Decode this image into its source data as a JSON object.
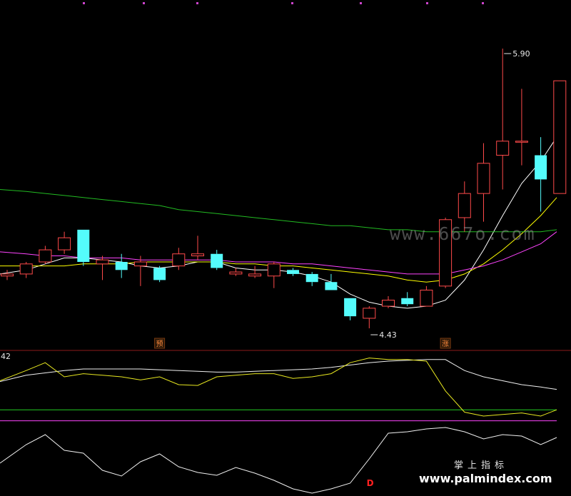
{
  "chart_data": {
    "type": "candlestick",
    "candles": [
      {
        "open": 4.77,
        "close": 4.78,
        "high": 4.8,
        "low": 4.75
      },
      {
        "open": 4.78,
        "close": 4.83,
        "high": 4.84,
        "low": 4.76
      },
      {
        "open": 4.84,
        "close": 4.9,
        "high": 4.92,
        "low": 4.83
      },
      {
        "open": 4.9,
        "close": 4.96,
        "high": 4.99,
        "low": 4.88
      },
      {
        "open": 5.0,
        "close": 4.84,
        "high": 5.0,
        "low": 4.82
      },
      {
        "open": 4.83,
        "close": 4.85,
        "high": 4.87,
        "low": 4.75
      },
      {
        "open": 4.84,
        "close": 4.8,
        "high": 4.88,
        "low": 4.76
      },
      {
        "open": 4.82,
        "close": 4.84,
        "high": 4.87,
        "low": 4.72
      },
      {
        "open": 4.81,
        "close": 4.75,
        "high": 4.82,
        "low": 4.74
      },
      {
        "open": 4.82,
        "close": 4.88,
        "high": 4.91,
        "low": 4.8
      },
      {
        "open": 4.87,
        "close": 4.88,
        "high": 4.97,
        "low": 4.85
      },
      {
        "open": 4.88,
        "close": 4.81,
        "high": 4.9,
        "low": 4.8
      },
      {
        "open": 4.78,
        "close": 4.79,
        "high": 4.81,
        "low": 4.77
      },
      {
        "open": 4.77,
        "close": 4.78,
        "high": 4.82,
        "low": 4.76
      },
      {
        "open": 4.77,
        "close": 4.83,
        "high": 4.84,
        "low": 4.71
      },
      {
        "open": 4.8,
        "close": 4.78,
        "high": 4.81,
        "low": 4.77
      },
      {
        "open": 4.78,
        "close": 4.74,
        "high": 4.79,
        "low": 4.72
      },
      {
        "open": 4.74,
        "close": 4.7,
        "high": 4.78,
        "low": 4.7
      },
      {
        "open": 4.66,
        "close": 4.57,
        "high": 4.66,
        "low": 4.55
      },
      {
        "open": 4.56,
        "close": 4.61,
        "high": 4.62,
        "low": 4.51
      },
      {
        "open": 4.62,
        "close": 4.65,
        "high": 4.67,
        "low": 4.61
      },
      {
        "open": 4.66,
        "close": 4.63,
        "high": 4.69,
        "low": 4.62
      },
      {
        "open": 4.62,
        "close": 4.7,
        "high": 4.72,
        "low": 4.62
      },
      {
        "open": 4.72,
        "close": 5.05,
        "high": 5.06,
        "low": 4.71
      },
      {
        "open": 5.06,
        "close": 5.18,
        "high": 5.24,
        "low": 4.99
      },
      {
        "open": 5.18,
        "close": 5.33,
        "high": 5.43,
        "low": 5.04
      },
      {
        "open": 5.37,
        "close": 5.44,
        "high": 5.9,
        "low": 5.2
      },
      {
        "open": 5.44,
        "close": 5.44,
        "high": 5.7,
        "low": 5.32
      },
      {
        "open": 5.37,
        "close": 5.25,
        "high": 5.46,
        "low": 5.09
      },
      {
        "open": 5.18,
        "close": 5.74,
        "high": 5.74,
        "low": 5.18
      }
    ],
    "moving_averages": [
      {
        "color": "#ffffff",
        "values": [
          4.78,
          4.8,
          4.83,
          4.86,
          4.86,
          4.85,
          4.84,
          4.82,
          4.81,
          4.82,
          4.84,
          4.84,
          4.81,
          4.8,
          4.8,
          4.79,
          4.77,
          4.74,
          4.68,
          4.64,
          4.62,
          4.61,
          4.62,
          4.65,
          4.75,
          4.9,
          5.07,
          5.23,
          5.34,
          5.46
        ]
      },
      {
        "color": "#ffff00",
        "values": [
          4.82,
          4.82,
          4.82,
          4.82,
          4.83,
          4.83,
          4.83,
          4.84,
          4.84,
          4.84,
          4.84,
          4.84,
          4.83,
          4.83,
          4.82,
          4.82,
          4.81,
          4.8,
          4.79,
          4.78,
          4.77,
          4.75,
          4.74,
          4.75,
          4.78,
          4.83,
          4.9,
          4.98,
          5.07,
          5.16
        ]
      },
      {
        "color": "#ff44ff",
        "values": [
          4.89,
          4.88,
          4.87,
          4.87,
          4.86,
          4.86,
          4.86,
          4.85,
          4.85,
          4.85,
          4.85,
          4.85,
          4.84,
          4.84,
          4.84,
          4.83,
          4.83,
          4.82,
          4.81,
          4.8,
          4.79,
          4.78,
          4.78,
          4.78,
          4.8,
          4.82,
          4.85,
          4.89,
          4.93,
          4.99
        ]
      },
      {
        "color": "#22bb22",
        "values": [
          5.2,
          5.19,
          5.18,
          5.17,
          5.16,
          5.15,
          5.14,
          5.13,
          5.12,
          5.1,
          5.09,
          5.08,
          5.07,
          5.06,
          5.05,
          5.04,
          5.03,
          5.02,
          5.02,
          5.01,
          5.0,
          5.0,
          4.99,
          4.99,
          4.99,
          4.99,
          4.99,
          4.99,
          4.99,
          5.0
        ]
      }
    ],
    "annotations": [
      {
        "candle": 26,
        "at": "high",
        "text": "5.90"
      },
      {
        "candle": 19,
        "at": "low",
        "text": "4.43"
      }
    ],
    "signals": [
      {
        "candle": 8,
        "text": "预"
      },
      {
        "candle": 23,
        "text": "涨"
      }
    ],
    "sub_label": "42",
    "indicator_upper": {
      "white": [
        34,
        42,
        45,
        48,
        50,
        50,
        50,
        50,
        49,
        48,
        47,
        46,
        46,
        47,
        48,
        49,
        50,
        52,
        55,
        58,
        60,
        61,
        62,
        62,
        48,
        40,
        35,
        30,
        27,
        24
      ],
      "yellow": [
        35,
        48,
        58,
        40,
        44,
        42,
        40,
        36,
        40,
        30,
        29,
        40,
        42,
        44,
        44,
        38,
        40,
        44,
        58,
        64,
        62,
        62,
        60,
        22,
        -5,
        -10,
        -8,
        -6,
        -10,
        -2
      ],
      "green_level": -2,
      "magenta_level": -16
    },
    "indicator_lower": {
      "white": [
        -14,
        12,
        26,
        4,
        0,
        -24,
        -32,
        -12,
        -1,
        -19,
        -27,
        -31,
        -20,
        -28,
        -38,
        -50,
        -56,
        -50,
        -42,
        -8,
        28,
        30,
        34,
        36,
        30,
        20,
        26,
        24,
        12,
        22
      ],
      "lower_level": -58,
      "marker": {
        "candle": 18,
        "text": "D"
      }
    },
    "watermark_url": "www.667o.com",
    "brand_cn": "掌上指标",
    "brand_url": "www.palmindex.com"
  }
}
